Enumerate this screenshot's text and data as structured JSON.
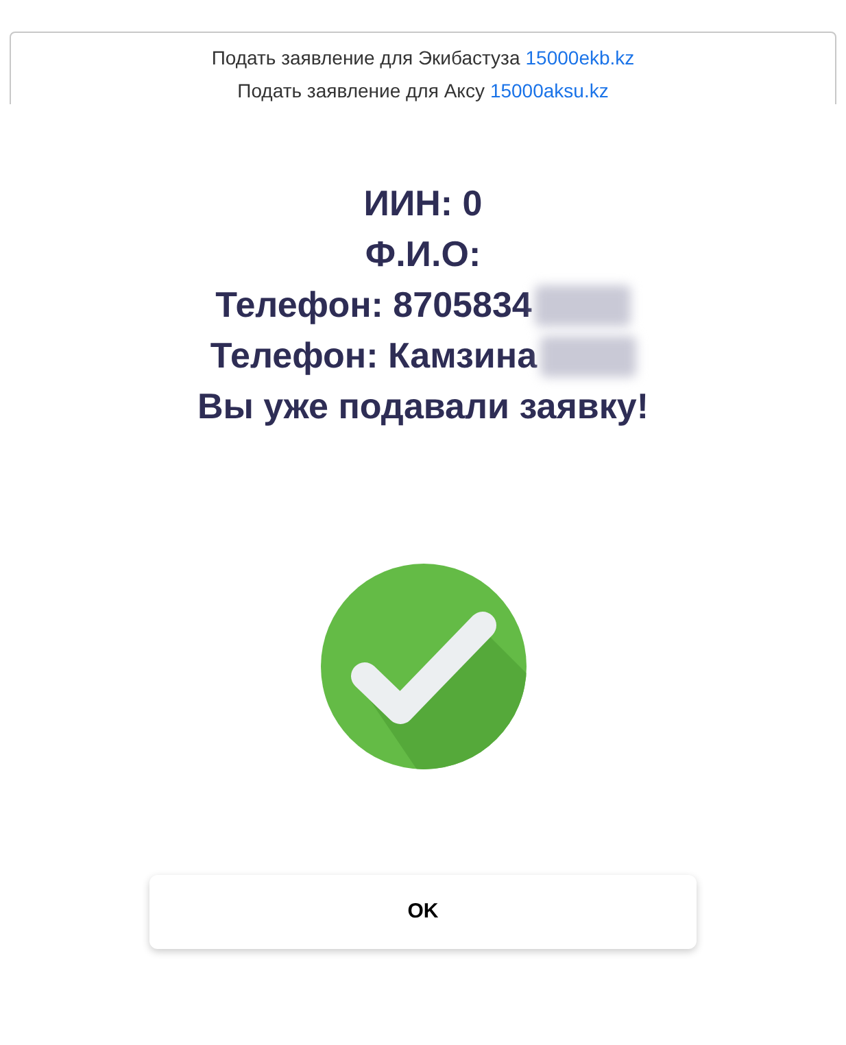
{
  "notice": [
    {
      "text": "Подать заявление для Экибастуза",
      "link": "15000ekb.kz"
    },
    {
      "text": "Подать заявление для Аксу",
      "link": "15000aksu.kz"
    }
  ],
  "dialog": {
    "lines": [
      {
        "text": "ИИН: 0",
        "redacted": false
      },
      {
        "text": "Ф.И.О:",
        "redacted": false
      },
      {
        "text": "Телефон: 8705834",
        "redacted": true
      },
      {
        "text": "Телефон: Камзина",
        "redacted": true
      },
      {
        "text": "Вы уже подавали заявку!",
        "redacted": false
      }
    ],
    "button": "OK"
  }
}
